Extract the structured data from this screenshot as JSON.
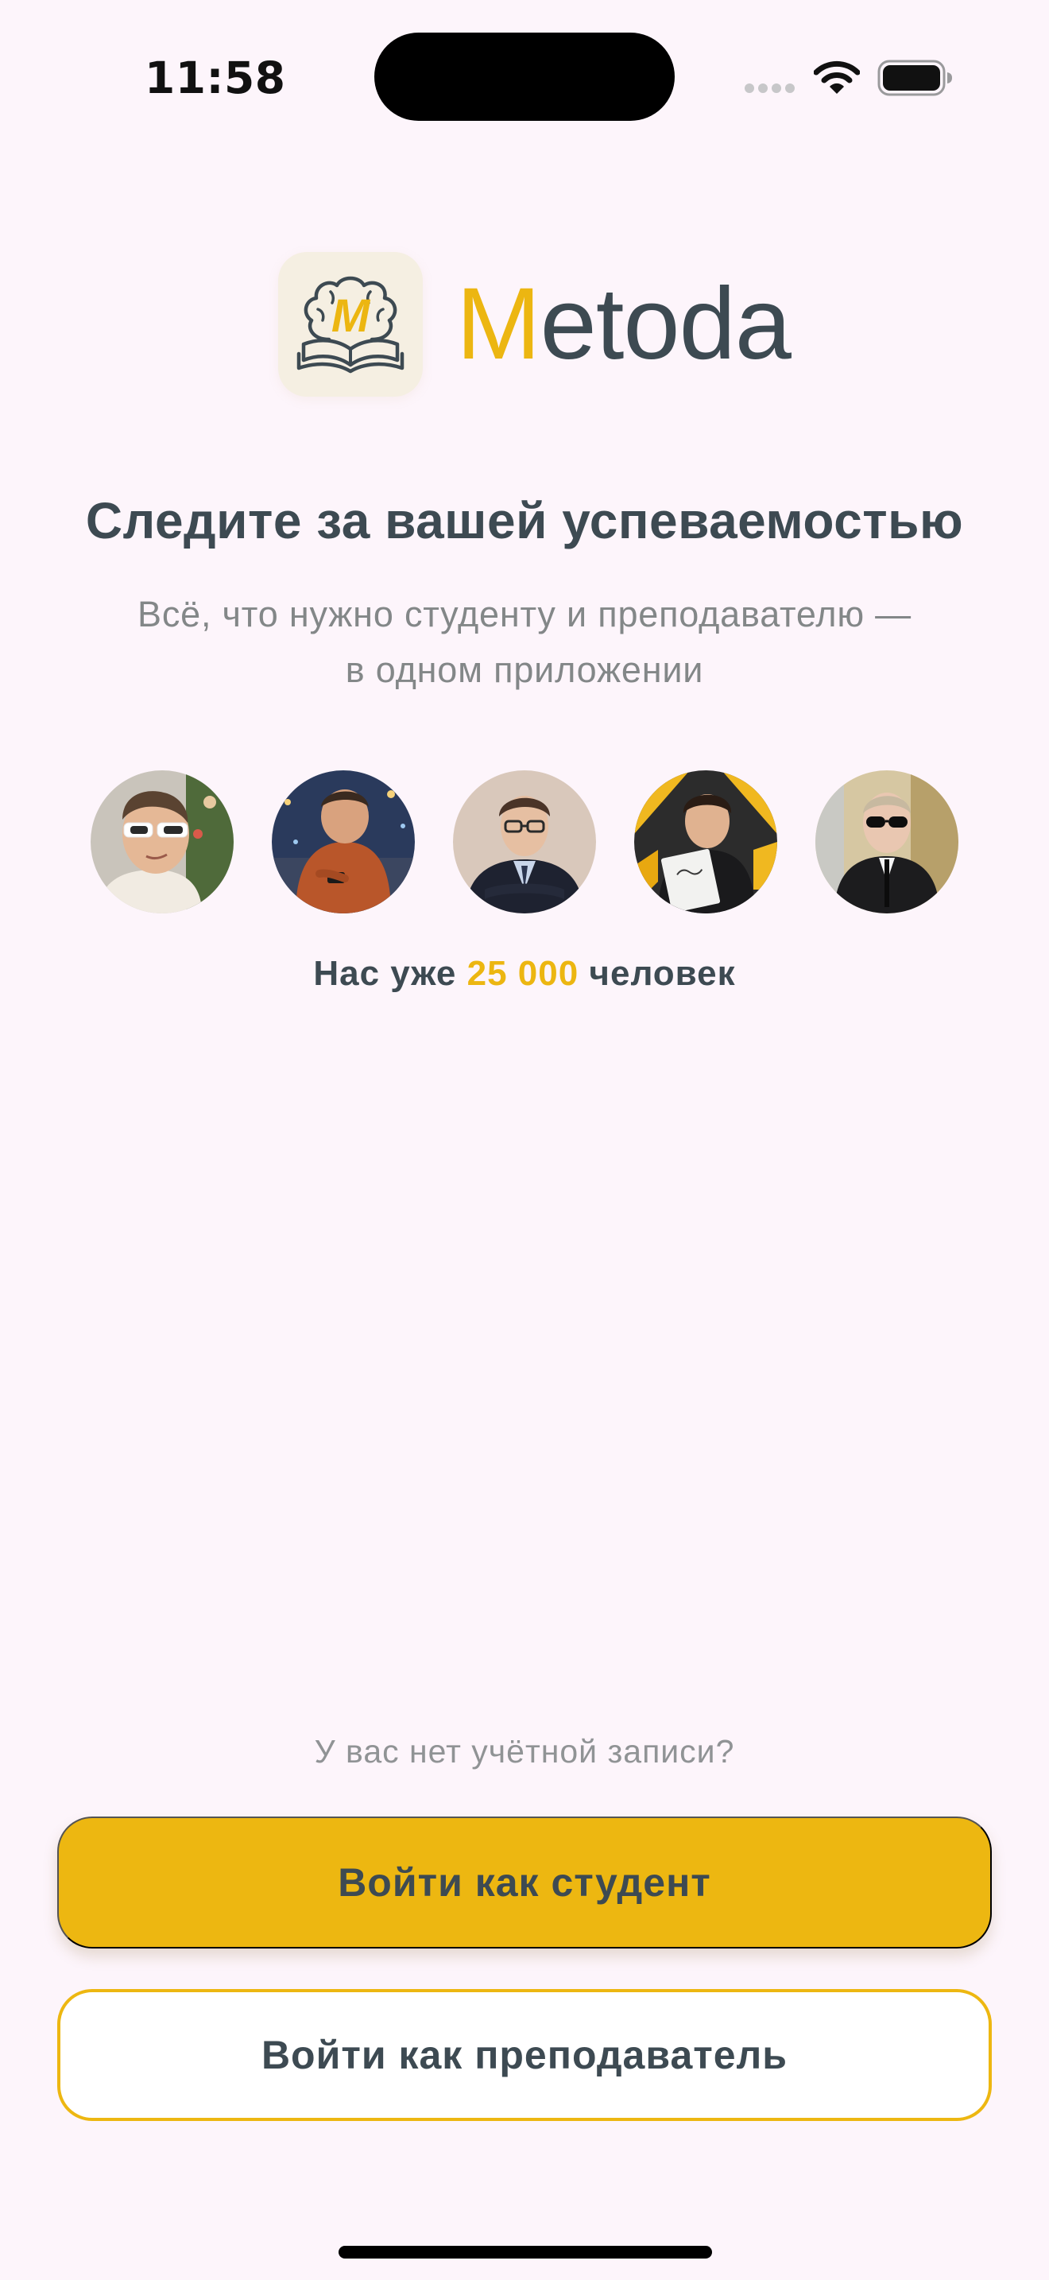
{
  "status_bar": {
    "time": "11:58",
    "icons": [
      "cellular-signal-icon",
      "wifi-icon",
      "battery-icon"
    ]
  },
  "brand": {
    "logo_icon": "brain-book-icon",
    "logo_letter": "M",
    "name_first": "M",
    "name_rest": "etoda",
    "accent_color": "#ecb611",
    "text_color": "#3d4a52"
  },
  "hero": {
    "title": "Следите за вашей успеваемостью",
    "subtitle_line1": "Всё, что нужно студенту и преподавателю —",
    "subtitle_line2": "в одном приложении"
  },
  "community": {
    "avatars": [
      "user-photo-1",
      "user-photo-2",
      "user-photo-3",
      "user-photo-4",
      "user-photo-5"
    ],
    "count_prefix": "Нас уже",
    "count_value": "25 000",
    "count_suffix": "человек"
  },
  "auth": {
    "no_account_text": "У вас нет учётной записи?",
    "student_button_label": "Войти как студент",
    "teacher_button_label": "Войти как преподаватель"
  },
  "colors": {
    "background": "#fdf5fb",
    "primary": "#edb711"
  }
}
